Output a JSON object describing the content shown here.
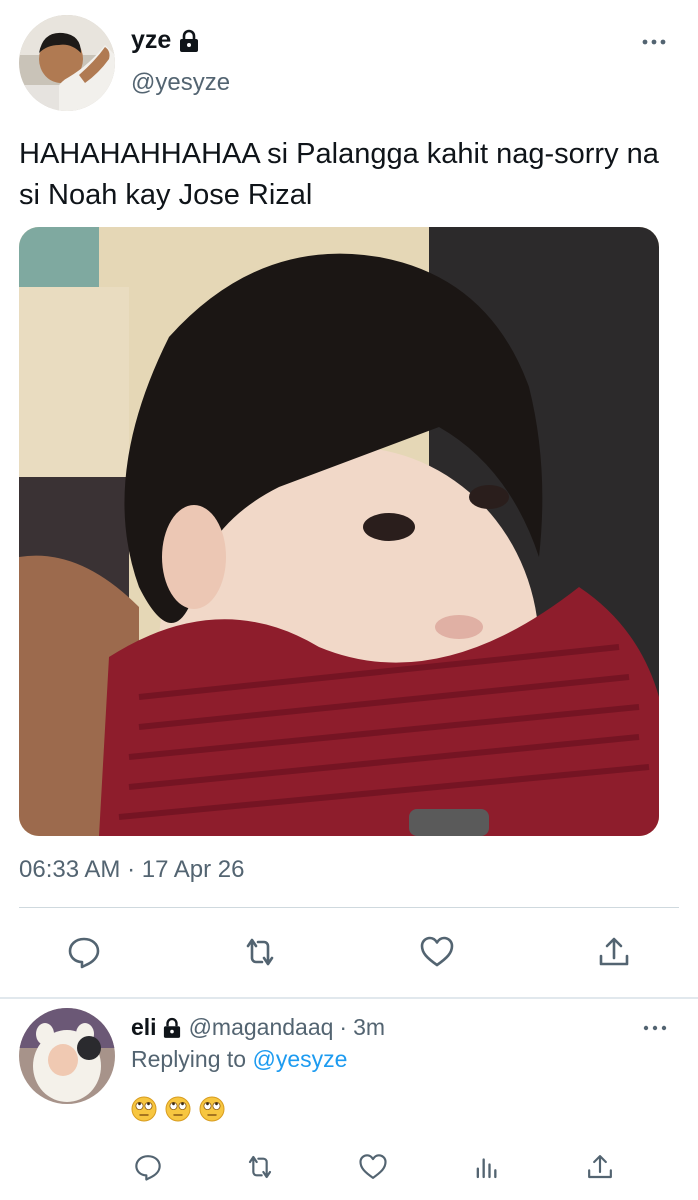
{
  "tweet": {
    "display_name": "yze",
    "handle": "@yesyze",
    "text": "HAHAHAHHAHAA si Palangga kahit nag-sorry na si Noah kay Jose Rizal",
    "timestamp": "06:33 AM · 17 Apr 26",
    "icons": {
      "lock": "lock-icon",
      "more": "more-icon",
      "reply": "reply-icon",
      "retweet": "retweet-icon",
      "like": "heart-icon",
      "share": "share-icon"
    }
  },
  "reply": {
    "display_name": "eli",
    "handle": "@magandaaq",
    "separator": "·",
    "time": "3m",
    "replying_prefix": "Replying to",
    "replying_to": "@yesyze",
    "emojis": [
      "🙄",
      "🙄",
      "🙄"
    ],
    "icons": {
      "reply": "reply-icon",
      "retweet": "retweet-icon",
      "like": "heart-icon",
      "analytics": "analytics-icon",
      "share": "share-icon"
    }
  },
  "colors": {
    "text": "#0f1419",
    "secondary": "#536471",
    "link": "#1d9bf0",
    "divider": "#cfd9de"
  }
}
